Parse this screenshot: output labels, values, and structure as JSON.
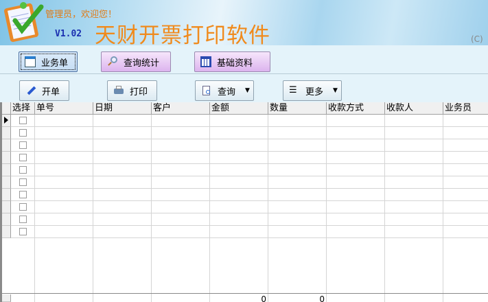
{
  "header": {
    "welcome": "管理员，欢迎您！",
    "version": "V1.02",
    "title": "天财开票打印软件",
    "copyright": "(C)"
  },
  "nav": [
    {
      "label": "业务单",
      "icon": "document-icon",
      "active": true
    },
    {
      "label": "查询统计",
      "icon": "search-icon"
    },
    {
      "label": "基础资料",
      "icon": "calendar-icon"
    }
  ],
  "toolbar": {
    "new_label": "开单",
    "print_label": "打印",
    "query_label": "查询",
    "more_label": "更多"
  },
  "grid": {
    "columns": [
      "选择",
      "单号",
      "日期",
      "客户",
      "金额",
      "数量",
      "收款方式",
      "收款人",
      "业务员"
    ],
    "row_count": 10,
    "totals": {
      "amount": "0",
      "quantity": "0"
    }
  },
  "colors": {
    "title": "#f08a1c",
    "version": "#1a2fb0",
    "nav_bg": "#e4f3fa"
  }
}
